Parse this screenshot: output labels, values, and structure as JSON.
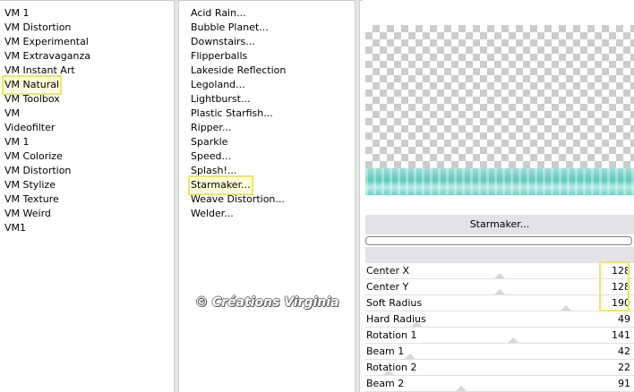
{
  "categories": [
    "VM 1",
    "VM Distortion",
    "VM Experimental",
    "VM Extravaganza",
    "VM Instant Art",
    "VM Natural",
    "VM Toolbox",
    "VM",
    "Videofilter",
    "VM 1",
    "VM Colorize",
    "VM Distortion",
    "VM Stylize",
    "VM Texture",
    "VM Weird",
    "VM1"
  ],
  "selected_category": "VM Natural",
  "filters": [
    "Acid Rain...",
    "Bubble Planet...",
    "Downstairs...",
    "Flipperballs",
    "Lakeside Reflection",
    "Legoland...",
    "Lightburst...",
    "Plastic Starfish...",
    "Ripper...",
    "Sparkle",
    "Speed...",
    "Splash!...",
    "Starmaker...",
    "Weave Distortion...",
    "Welder..."
  ],
  "selected_filter": "Starmaker...",
  "panel": {
    "filter_name": "Starmaker...",
    "params": [
      {
        "label": "Center X",
        "value": "128",
        "level": 0.5
      },
      {
        "label": "Center Y",
        "value": "128",
        "level": 0.5
      },
      {
        "label": "Soft Radius",
        "value": "190",
        "level": 0.745
      },
      {
        "label": "Hard Radius",
        "value": "49",
        "level": 0.19
      },
      {
        "label": "Rotation 1",
        "value": "141",
        "level": 0.55
      },
      {
        "label": "Beam 1",
        "value": "42",
        "level": 0.165
      },
      {
        "label": "Rotation 2",
        "value": "22",
        "level": 0.086
      },
      {
        "label": "Beam 2",
        "value": "91",
        "level": 0.357
      }
    ]
  },
  "watermark": "© Créations Virginia"
}
